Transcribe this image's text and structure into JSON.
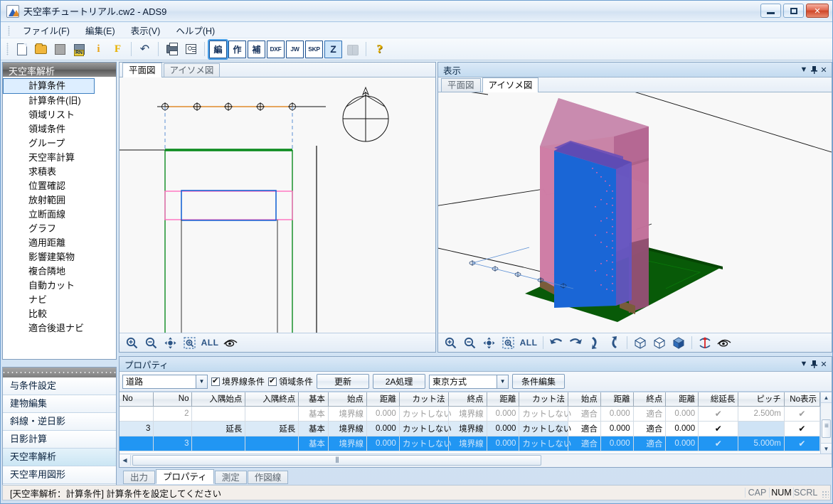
{
  "window": {
    "title": "天空率チュートリアル.cw2 - ADS9",
    "app_icon": "ads-app-icon",
    "minimize": "–",
    "maximize": "□",
    "close": "✕"
  },
  "menubar": {
    "items": [
      {
        "label": "ファイル(F)"
      },
      {
        "label": "編集(E)"
      },
      {
        "label": "表示(V)"
      },
      {
        "label": "ヘルプ(H)"
      }
    ]
  },
  "toolbar": {
    "groups": [
      [
        {
          "name": "new-document-icon",
          "label": ""
        },
        {
          "name": "open-folder-icon",
          "label": ""
        },
        {
          "name": "save-icon",
          "label": ""
        },
        {
          "name": "save-rename-icon",
          "label": ""
        },
        {
          "name": "info-icon",
          "label": ""
        },
        {
          "name": "font-icon",
          "label": "F"
        }
      ],
      [
        {
          "name": "undo-icon",
          "label": ""
        }
      ],
      [
        {
          "name": "print-icon",
          "label": ""
        },
        {
          "name": "print-preview-icon",
          "label": ""
        }
      ],
      [
        {
          "name": "mode-edit-button",
          "label": "編",
          "selected": true
        },
        {
          "name": "mode-create-button",
          "label": "作",
          "selected": false
        },
        {
          "name": "mode-assist-button",
          "label": "補",
          "selected": false
        },
        {
          "name": "export-dxf-button",
          "label": "DXF",
          "selected": false
        },
        {
          "name": "export-jw-button",
          "label": "JW",
          "selected": false
        },
        {
          "name": "export-skp-button",
          "label": "SKP",
          "selected": false
        },
        {
          "name": "mode-z-button",
          "label": "Z",
          "selected": true
        },
        {
          "name": "binoculars-icon",
          "label": "",
          "disabled": true
        }
      ],
      [
        {
          "name": "help-icon",
          "label": "?"
        }
      ]
    ]
  },
  "sidebar": {
    "header": "天空率解析",
    "items": [
      {
        "label": "計算条件",
        "selected": true
      },
      {
        "label": "計算条件(旧)",
        "selected": false
      },
      {
        "label": "領域リスト",
        "selected": false
      },
      {
        "label": "領域条件",
        "selected": false
      },
      {
        "label": "グループ",
        "selected": false
      },
      {
        "label": "天空率計算",
        "selected": false
      },
      {
        "label": "求積表",
        "selected": false
      },
      {
        "label": "位置確認",
        "selected": false
      },
      {
        "label": "放射範囲",
        "selected": false
      },
      {
        "label": "立断面線",
        "selected": false
      },
      {
        "label": "グラフ",
        "selected": false
      },
      {
        "label": "適用距離",
        "selected": false
      },
      {
        "label": "影響建築物",
        "selected": false
      },
      {
        "label": "複合隣地",
        "selected": false
      },
      {
        "label": "自動カット",
        "selected": false
      },
      {
        "label": "ナビ",
        "selected": false
      },
      {
        "label": "比較",
        "selected": false
      },
      {
        "label": "適合後退ナビ",
        "selected": false
      }
    ]
  },
  "nav_panel": {
    "items": [
      {
        "label": "与条件設定",
        "active": false
      },
      {
        "label": "建物編集",
        "active": false
      },
      {
        "label": "斜線・逆日影",
        "active": false
      },
      {
        "label": "日影計算",
        "active": false
      },
      {
        "label": "天空率解析",
        "active": true
      },
      {
        "label": "天空率用図形",
        "active": false
      }
    ],
    "more_label": "»",
    "down_label": "▼"
  },
  "plan_panel": {
    "tabs": [
      {
        "label": "平面図",
        "active": true
      },
      {
        "label": "アイソメ図",
        "active": false
      }
    ],
    "toolbar": [
      {
        "name": "zoom-in-icon",
        "label": ""
      },
      {
        "name": "zoom-out-icon",
        "label": ""
      },
      {
        "name": "pan-icon",
        "label": ""
      },
      {
        "name": "zoom-window-icon",
        "label": ""
      },
      {
        "name": "zoom-all-button",
        "label": "ALL"
      },
      {
        "name": "eye-view-icon",
        "label": ""
      }
    ]
  },
  "view_panel": {
    "title": "表示",
    "dock_buttons": [
      {
        "name": "dock-menu-icon",
        "label": "▼"
      },
      {
        "name": "pin-icon",
        "label": "⊓"
      },
      {
        "name": "close-icon",
        "label": "✕"
      }
    ],
    "tabs": [
      {
        "label": "平面図",
        "active": false
      },
      {
        "label": "アイソメ図",
        "active": true
      }
    ],
    "toolbar": [
      {
        "name": "zoom-in-icon",
        "label": ""
      },
      {
        "name": "zoom-out-icon",
        "label": ""
      },
      {
        "name": "pan-icon",
        "label": ""
      },
      {
        "name": "zoom-window-icon",
        "label": ""
      },
      {
        "name": "zoom-all-button",
        "label": "ALL"
      },
      {
        "name": "rotate-left-icon",
        "label": ""
      },
      {
        "name": "rotate-right-icon",
        "label": ""
      },
      {
        "name": "rotate-down-icon",
        "label": ""
      },
      {
        "name": "rotate-up-icon",
        "label": ""
      },
      {
        "name": "wireframe-box-icon",
        "label": ""
      },
      {
        "name": "hidden-line-box-icon",
        "label": ""
      },
      {
        "name": "shaded-box-icon",
        "label": ""
      },
      {
        "name": "axis-rotate-icon",
        "label": ""
      },
      {
        "name": "eye-view-icon",
        "label": ""
      }
    ]
  },
  "property_panel": {
    "title": "プロパティ",
    "dock_buttons": [
      {
        "name": "dock-menu-icon",
        "label": "▼"
      },
      {
        "name": "pin-icon",
        "label": "⊓"
      },
      {
        "name": "close-icon",
        "label": "✕"
      }
    ],
    "toolbar": {
      "type_select": {
        "value": "道路",
        "arrow": "▼"
      },
      "boundary_checkbox": {
        "label": "境界線条件",
        "checked": true
      },
      "area_checkbox": {
        "label": "領域条件",
        "checked": true
      },
      "update_button": "更新",
      "process2a_button": "2A処理",
      "method_select": {
        "value": "東京方式",
        "arrow": "▼"
      },
      "edit_conditions_button": "条件編集"
    },
    "table": {
      "headers": [
        "No",
        "No",
        "入隅始点",
        "入隅終点",
        "基本",
        "始点",
        "距離",
        "カット法",
        "終点",
        "距離",
        "カット法",
        "始点",
        "距離",
        "終点",
        "距離",
        "総延長",
        "ピッチ",
        "No表示"
      ],
      "rows": [
        {
          "state": "disabled",
          "cells": [
            "",
            "2",
            "",
            "",
            "基本",
            "境界線",
            "0.000",
            "カットしない",
            "境界線",
            "0.000",
            "カットしない",
            "適合",
            "0.000",
            "適合",
            "0.000",
            "✔",
            "2.500m",
            "✔"
          ]
        },
        {
          "state": "normal",
          "cells": [
            "3",
            "",
            "延長",
            "延長",
            "基本",
            "境界線",
            "0.000",
            "カットしない",
            "境界線",
            "0.000",
            "カットしない",
            "適合",
            "0.000",
            "適合",
            "0.000",
            "✔",
            "",
            "✔"
          ]
        },
        {
          "state": "selected",
          "cells": [
            "",
            "3",
            "",
            "",
            "基本",
            "境界線",
            "0.000",
            "カットしない",
            "境界線",
            "0.000",
            "カットしない",
            "適合",
            "0.000",
            "適合",
            "0.000",
            "✔",
            "5.000m",
            "✔"
          ]
        }
      ]
    },
    "scroll": {
      "up_arrow": "▲",
      "down_arrow": "▼",
      "left_arrow": "◀",
      "right_arrow": "▶"
    }
  },
  "bottom_tabs": [
    {
      "label": "出力",
      "active": false
    },
    {
      "label": "プロパティ",
      "active": true
    },
    {
      "label": "測定",
      "active": false
    },
    {
      "label": "作図線",
      "active": false
    }
  ],
  "statusbar": {
    "message": "[天空率解析：計算条件] 計算条件を設定してください",
    "indicators": [
      {
        "label": "CAP",
        "active": false
      },
      {
        "label": "NUM",
        "active": true
      },
      {
        "label": "SCRL",
        "active": false
      }
    ]
  },
  "colors": {
    "accent": "#2196f3",
    "boundary_green": "#0a8a1e",
    "area_pink": "#ff6fbf",
    "building_blue": "#1a66d6",
    "road_orange": "#e08a2a",
    "envelope_pink": "#c playing"
  }
}
